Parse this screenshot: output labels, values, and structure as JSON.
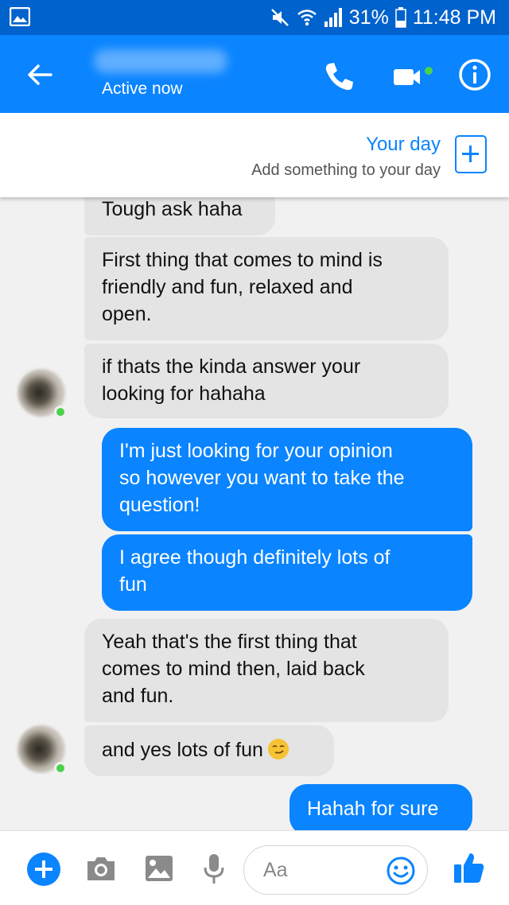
{
  "status_bar": {
    "battery": "31%",
    "time": "11:48 PM",
    "icons": [
      "gallery-icon",
      "mute-icon",
      "wifi-icon",
      "signal-icon",
      "battery-icon"
    ]
  },
  "header": {
    "status": "Active now",
    "icons": [
      "back-arrow-icon",
      "phone-icon",
      "video-camera-icon",
      "info-icon"
    ]
  },
  "your_day": {
    "title": "Your day",
    "subtitle": "Add something to your day"
  },
  "messages": [
    {
      "from": "them",
      "lines": [
        "Tough ask haha"
      ]
    },
    {
      "from": "them",
      "lines": [
        "First thing that comes to mind is",
        "friendly and fun, relaxed and",
        "open."
      ]
    },
    {
      "from": "them",
      "lines": [
        "if thats the kinda answer your",
        "looking for hahaha"
      ]
    },
    {
      "from": "me",
      "lines": [
        "I'm just looking for your opinion",
        "so however you want to take the",
        "question!"
      ]
    },
    {
      "from": "me",
      "lines": [
        "I agree though definitely lots of",
        "fun"
      ]
    },
    {
      "from": "them",
      "lines": [
        "Yeah that's the first thing that",
        "comes to mind then, laid back",
        "and fun."
      ]
    },
    {
      "from": "them",
      "lines": [
        "and yes lots of fun"
      ],
      "emoji": "smirk-emoji-icon"
    },
    {
      "from": "me",
      "lines": [
        "Hahah for sure"
      ]
    }
  ],
  "composer": {
    "placeholder": "Aa",
    "icons": [
      "plus-icon",
      "camera-icon",
      "image-icon",
      "microphone-icon",
      "emoji-icon",
      "thumbs-up-icon"
    ]
  },
  "colors": {
    "header_blue": "#0a84ff",
    "status_bar_blue": "#0062cc",
    "incoming_bubble": "#e4e4e4",
    "outgoing_bubble": "#0a84ff",
    "online_green": "#4bd24b"
  }
}
